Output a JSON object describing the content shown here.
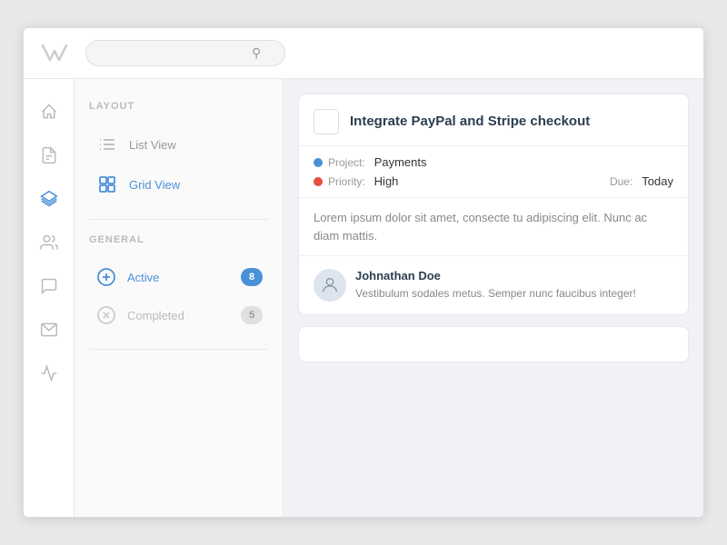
{
  "header": {
    "logo_alt": "Logo",
    "search_placeholder": ""
  },
  "sidebar_icons": [
    {
      "name": "home-icon",
      "label": "Home"
    },
    {
      "name": "files-icon",
      "label": "Files"
    },
    {
      "name": "layers-icon",
      "label": "Layers",
      "active": true
    },
    {
      "name": "users-icon",
      "label": "Users"
    },
    {
      "name": "comments-icon",
      "label": "Comments"
    },
    {
      "name": "mail-icon",
      "label": "Mail"
    },
    {
      "name": "analytics-icon",
      "label": "Analytics"
    }
  ],
  "sidebar_panel": {
    "layout_section_label": "LAYOUT",
    "layout_options": [
      {
        "label": "List View",
        "active": false
      },
      {
        "label": "Grid View",
        "active": true
      }
    ],
    "general_section_label": "GENERAL",
    "filter_items": [
      {
        "label": "Active",
        "count": 8,
        "badge_type": "blue",
        "active": true
      },
      {
        "label": "Completed",
        "count": 5,
        "badge_type": "gray",
        "active": false
      }
    ]
  },
  "main": {
    "task": {
      "title": "Integrate PayPal and Stripe checkout",
      "project_label": "Project:",
      "project_value": "Payments",
      "priority_label": "Priority:",
      "priority_value": "High",
      "due_label": "Due:",
      "due_value": "Today",
      "description": "Lorem ipsum dolor sit amet, consecte tu adipiscing elit. Nunc ac diam mattis.",
      "comment": {
        "author": "Johnathan Doe",
        "text": "Vestibulum sodales metus. Semper nunc faucibus integer!"
      }
    }
  }
}
